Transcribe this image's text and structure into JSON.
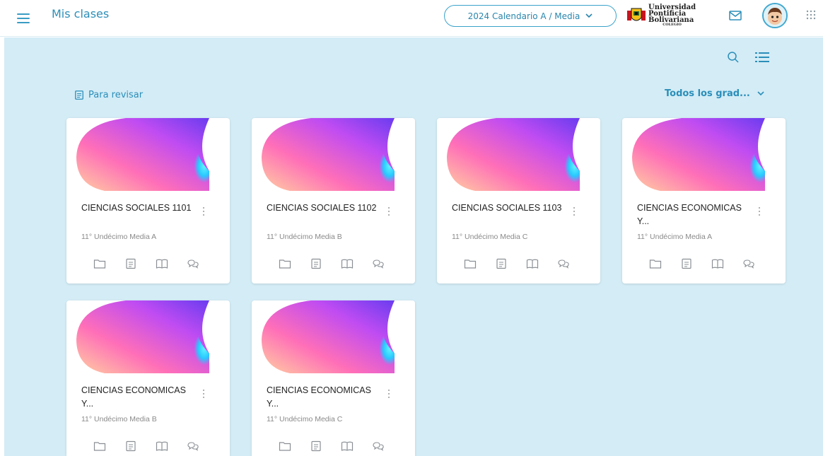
{
  "header": {
    "title": "Mis clases",
    "calendar_label": "2024 Calendario A / Media",
    "logo_lines": [
      "Universidad",
      "Pontificia",
      "Bolivariana",
      "COLEGIO"
    ]
  },
  "toolbar": {
    "review_label": "Para revisar",
    "grade_filter": "Todos los grad..."
  },
  "colors": {
    "accent": "#2b8eb9",
    "content_bg": "#d3ecf6"
  },
  "cards": [
    {
      "title": "CIENCIAS SOCIALES 1101",
      "subtitle": "11° Undécimo Media A"
    },
    {
      "title": "CIENCIAS SOCIALES 1102",
      "subtitle": "11° Undécimo Media B"
    },
    {
      "title": "CIENCIAS SOCIALES 1103",
      "subtitle": "11° Undécimo Media C"
    },
    {
      "title": "CIENCIAS ECONOMICAS Y...",
      "subtitle": "11° Undécimo Media A"
    },
    {
      "title": "CIENCIAS ECONOMICAS Y...",
      "subtitle": "11° Undécimo Media B"
    },
    {
      "title": "CIENCIAS ECONOMICAS Y...",
      "subtitle": "11° Undécimo Media C"
    }
  ],
  "card_actions": [
    "folder-icon",
    "assignment-icon",
    "book-icon",
    "chat-icon"
  ]
}
